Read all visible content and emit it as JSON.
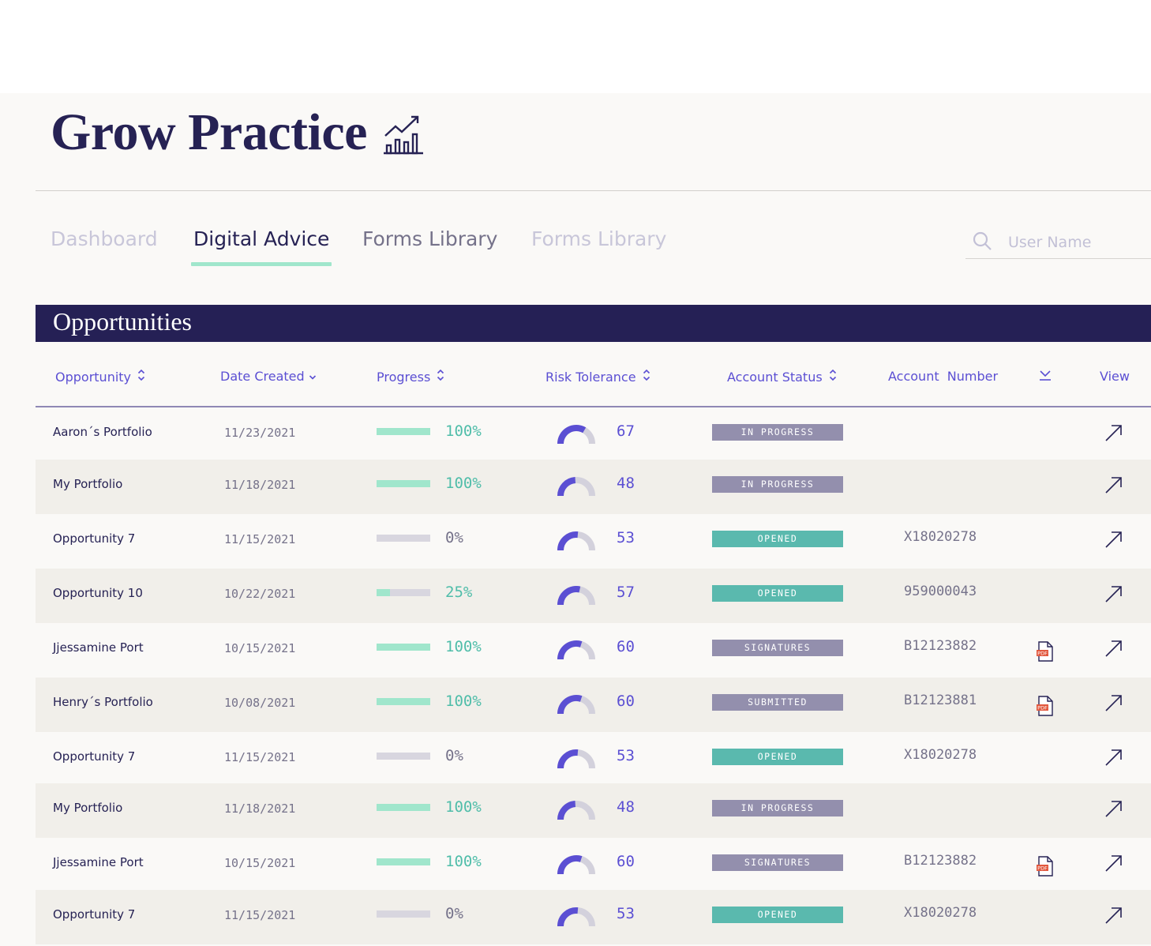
{
  "page": {
    "title": "Grow Practice",
    "title_icon": "growth-chart-icon"
  },
  "tabs": [
    {
      "label": "Dashboard",
      "state": "faded",
      "color": "#c8c6d9"
    },
    {
      "label": "Digital Advice",
      "state": "active",
      "color": "#262254"
    },
    {
      "label": "Forms Library",
      "state": "normal",
      "color": "#75728a"
    },
    {
      "label": "Forms Library",
      "state": "faded",
      "color": "#c8c6d9"
    }
  ],
  "search": {
    "placeholder": "User Name",
    "value": ""
  },
  "section": {
    "title": "Opportunities"
  },
  "columns": {
    "opportunity": "Opportunity",
    "date_created": "Date Created",
    "progress": "Progress",
    "risk_tolerance": "Risk Tolerance",
    "account_status": "Account Status",
    "account_number": "Account  Number",
    "download_icon": "download-icon",
    "view": "View"
  },
  "colors": {
    "accent": "#5b4fd3",
    "navy": "#252055",
    "mint": "#a0e6cc",
    "teal_text": "#4fbda9",
    "status_gray": "#938fad",
    "status_teal": "#5ab9ae",
    "pdf_red": "#e2583e"
  },
  "rows": [
    {
      "name": "Aaron´s Portfolio",
      "date": "11/23/2021",
      "progress": 100,
      "progress_label": "100%",
      "risk": 67,
      "risk_label": "67",
      "status": "IN PROGRESS",
      "status_color": "#938fad",
      "account": "",
      "pdf": false
    },
    {
      "name": "My Portfolio",
      "date": "11/18/2021",
      "progress": 100,
      "progress_label": "100%",
      "risk": 48,
      "risk_label": "48",
      "status": "IN PROGRESS",
      "status_color": "#938fad",
      "account": "",
      "pdf": false
    },
    {
      "name": "Opportunity 7",
      "date": "11/15/2021",
      "progress": 0,
      "progress_label": "0%",
      "risk": 53,
      "risk_label": "53",
      "status": "OPENED",
      "status_color": "#5ab9ae",
      "account": "X18020278",
      "pdf": false
    },
    {
      "name": "Opportunity 10",
      "date": "10/22/2021",
      "progress": 25,
      "progress_label": "25%",
      "risk": 57,
      "risk_label": "57",
      "status": "OPENED",
      "status_color": "#5ab9ae",
      "account": "959000043",
      "pdf": false
    },
    {
      "name": "Jjessamine Port",
      "date": "10/15/2021",
      "progress": 100,
      "progress_label": "100%",
      "risk": 60,
      "risk_label": "60",
      "status": "SIGNATURES",
      "status_color": "#938fad",
      "account": "B12123882",
      "pdf": true
    },
    {
      "name": "Henry´s Portfolio",
      "date": "10/08/2021",
      "progress": 100,
      "progress_label": "100%",
      "risk": 60,
      "risk_label": "60",
      "status": "SUBMITTED",
      "status_color": "#938fad",
      "account": "B12123881",
      "pdf": true
    },
    {
      "name": "Opportunity 7",
      "date": "11/15/2021",
      "progress": 0,
      "progress_label": "0%",
      "risk": 53,
      "risk_label": "53",
      "status": "OPENED",
      "status_color": "#5ab9ae",
      "account": "X18020278",
      "pdf": false
    },
    {
      "name": "My Portfolio",
      "date": "11/18/2021",
      "progress": 100,
      "progress_label": "100%",
      "risk": 48,
      "risk_label": "48",
      "status": "IN PROGRESS",
      "status_color": "#938fad",
      "account": "",
      "pdf": false
    },
    {
      "name": "Jjessamine Port",
      "date": "10/15/2021",
      "progress": 100,
      "progress_label": "100%",
      "risk": 60,
      "risk_label": "60",
      "status": "SIGNATURES",
      "status_color": "#938fad",
      "account": "B12123882",
      "pdf": true
    },
    {
      "name": "Opportunity 7",
      "date": "11/15/2021",
      "progress": 0,
      "progress_label": "0%",
      "risk": 53,
      "risk_label": "53",
      "status": "OPENED",
      "status_color": "#5ab9ae",
      "account": "X18020278",
      "pdf": false
    }
  ]
}
